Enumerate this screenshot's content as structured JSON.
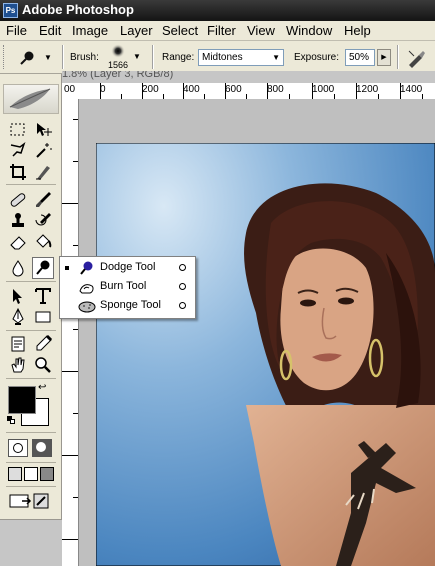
{
  "app": {
    "title": "Adobe Photoshop",
    "logo_icon": "photoshop-logo-icon"
  },
  "menu": [
    "File",
    "Edit",
    "Image",
    "Layer",
    "Select",
    "Filter",
    "View",
    "Window",
    "Help"
  ],
  "options_bar": {
    "brush_label": "Brush:",
    "brush_size": "1566",
    "range_label": "Range:",
    "range_value": "Midtones",
    "exposure_label": "Exposure:",
    "exposure_value": "50%"
  },
  "document": {
    "title_fragment": "1.8% (Layer 3, RGB/8)",
    "ruler_labels": [
      "00",
      "0",
      "200",
      "400",
      "600",
      "800",
      "1000",
      "1200",
      "1400"
    ]
  },
  "toolbox": {
    "tools": [
      "marquee-tool",
      "move-tool",
      "lasso-tool",
      "magic-wand-tool",
      "crop-tool",
      "slice-tool",
      "healing-brush-tool",
      "brush-tool",
      "clone-stamp-tool",
      "history-brush-tool",
      "eraser-tool",
      "paint-bucket-tool",
      "blur-tool",
      "dodge-tool",
      "path-selection-tool",
      "type-tool",
      "pen-tool",
      "rectangle-tool",
      "notes-tool",
      "eyedropper-tool",
      "hand-tool",
      "zoom-tool"
    ],
    "foreground_color": "#000000",
    "background_color": "#ffffff"
  },
  "flyout": {
    "items": [
      {
        "label": "Dodge Tool",
        "selected": true,
        "icon": "dodge-icon"
      },
      {
        "label": "Burn Tool",
        "selected": false,
        "icon": "burn-icon"
      },
      {
        "label": "Sponge Tool",
        "selected": false,
        "icon": "sponge-icon"
      }
    ]
  },
  "colors": {
    "title_bar": "#141414",
    "menu_bg": "#ece9d8",
    "canvas_sky": "#5d94c9"
  }
}
